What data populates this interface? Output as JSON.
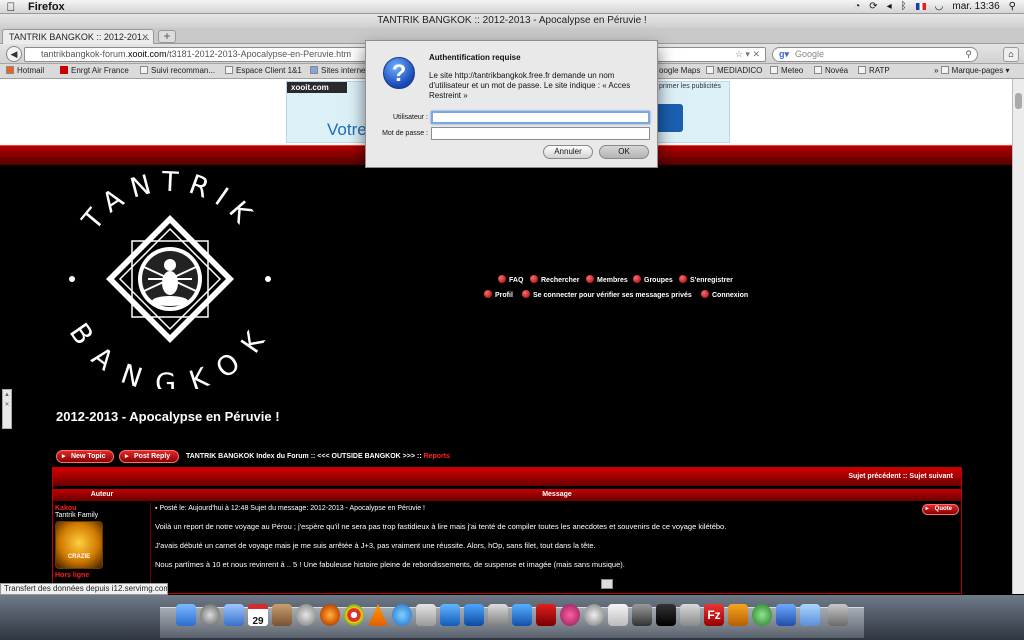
{
  "menubar": {
    "app_name": "Firefox",
    "clock": "mar. 13:36"
  },
  "window": {
    "title": "TANTRIK BANGKOK :: 2012-2013 - Apocalypse en Péruvie !"
  },
  "tabs": [
    {
      "label": "TANTRIK BANGKOK :: 2012-201..."
    }
  ],
  "navbar": {
    "url_prefix": "tantrikbangkok-forum.",
    "url_host": "xooit.com",
    "url_path": "/t3181-2012-2013-Apocalypse-en-Peruvie.htm",
    "search_placeholder": "Google"
  },
  "bookmarks": [
    {
      "label": "Hotmail"
    },
    {
      "label": "Enrgt Air France"
    },
    {
      "label": "Suivi recomman..."
    },
    {
      "label": "Espace Client 1&1"
    },
    {
      "label": "Sites interne"
    },
    {
      "label": "oogle Maps"
    },
    {
      "label": "MEDIADICO"
    },
    {
      "label": "Meteo"
    },
    {
      "label": "Novéa"
    },
    {
      "label": "RATP"
    },
    {
      "label": "Marque-pages"
    }
  ],
  "ad": {
    "brand": "xooit.com",
    "headline": "Votre",
    "mask_link": "primer les publicités"
  },
  "site": {
    "logo_text_top": "TANTRIK",
    "logo_text_bottom": "BANGKOK",
    "nav": [
      {
        "label": "FAQ"
      },
      {
        "label": "Rechercher"
      },
      {
        "label": "Membres"
      },
      {
        "label": "Groupes"
      },
      {
        "label": "S'enregistrer"
      },
      {
        "label": "Profil"
      },
      {
        "label": "Se connecter pour vérifier ses messages privés"
      },
      {
        "label": "Connexion"
      }
    ],
    "topic_title": "2012-2013 - Apocalypse en Péruvie !",
    "new_topic_label": "New Topic",
    "post_reply_label": "Post Reply",
    "breadcrumb": "TANTRIK BANGKOK Index du Forum :: <<< OUTSIDE BANGKOK >>> ::",
    "breadcrumb_current": "Reports"
  },
  "table": {
    "top_links": "Sujet précédent :: Sujet suivant",
    "col_author": "Auteur",
    "col_message": "Message",
    "post": {
      "author": "Kakou",
      "rank": "Tantrik Family",
      "avatar_text": "CRAZIE",
      "status": "Hors ligne",
      "meta": "Posté le: Aujourd'hui à 12:48    Sujet du message: 2012-2013 - Apocalypse en Péruvie !",
      "quote_label": "Quote",
      "paragraphs": [
        "Voilà un report de notre voyage au Pérou ; j'espère qu'il ne sera pas trop fastidieux à lire mais j'ai tenté de compiler toutes les anecdotes et souvenirs de ce voyage kilétébo.",
        "J'avais débuté un carnet de voyage mais je me suis arrêtée à J+3, pas vraiment une réussite. Alors, hOp, sans filet, tout dans la tête.",
        "Nous partîmes à 10 et nous revinrent à .. 5 ! Une fabuleuse histoire pleine de rebondissements, de suspense et imagée (mais sans musique)."
      ]
    }
  },
  "status_bar": "Transfert des données depuis i12.servimg.com...",
  "dialog": {
    "title": "Authentification requise",
    "message": "Le site http://tantrikbangkok.free.fr demande un nom d'utilisateur et un mot de passe. Le site indique : « Acces Restreint »",
    "user_label": "Utilisateur :",
    "user_value": "",
    "password_label": "Mot de passe :",
    "password_value": "",
    "cancel_label": "Annuler",
    "ok_label": "OK"
  },
  "dock": {
    "calendar_day": "29"
  },
  "colors": {
    "forum_red": "#c00000",
    "link_red": "#ff2020",
    "dialog_bg": "#e9e9e9"
  }
}
